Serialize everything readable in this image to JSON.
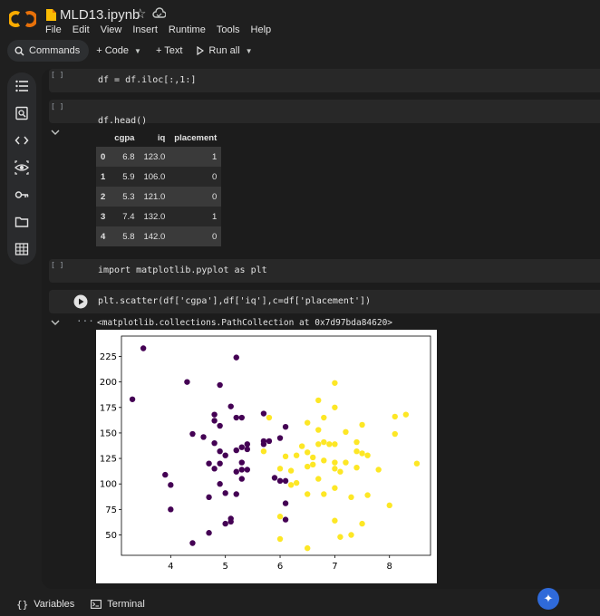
{
  "header": {
    "filename": "MLD13.ipynb",
    "star_glyph": "☆"
  },
  "menu": [
    "File",
    "Edit",
    "View",
    "Insert",
    "Runtime",
    "Tools",
    "Help"
  ],
  "toolbar": {
    "commands": "Commands",
    "code": "+ Code",
    "text": "+ Text",
    "run_all": "Run all"
  },
  "rail_icons": [
    "toc-icon",
    "find-icon",
    "code-snippets-icon",
    "variables-inspect-icon",
    "secrets-key-icon",
    "files-folder-icon",
    "table-icon"
  ],
  "cells": {
    "c1": {
      "bracket": "[ ]",
      "code": "df = df.iloc[:,1:]"
    },
    "c2": {
      "bracket": "[ ]",
      "code": "df.head()"
    },
    "c3": {
      "bracket": "[ ]",
      "code": "import matplotlib.pyplot as plt"
    },
    "c4": {
      "code": "plt.scatter(df['cgpa'],df['iq'],c=df['placement'])"
    }
  },
  "table": {
    "columns": [
      "",
      "cgpa",
      "iq",
      "placement"
    ],
    "rows": [
      [
        "0",
        "6.8",
        "123.0",
        "1"
      ],
      [
        "1",
        "5.9",
        "106.0",
        "0"
      ],
      [
        "2",
        "5.3",
        "121.0",
        "0"
      ],
      [
        "3",
        "7.4",
        "132.0",
        "1"
      ],
      [
        "4",
        "5.8",
        "142.0",
        "0"
      ]
    ]
  },
  "output_text": "<matplotlib.collections.PathCollection at 0x7d97bda84620>",
  "bottom": {
    "variables": "Variables",
    "terminal": "Terminal"
  },
  "colors": {
    "class0": "#440154",
    "class1": "#fde725",
    "accent_gemini": "#2f6ad9"
  },
  "chart_data": {
    "type": "scatter",
    "title": "",
    "xlabel": "",
    "ylabel": "",
    "xlim": [
      3.1,
      8.75
    ],
    "ylim": [
      30,
      245
    ],
    "xticks": [
      4,
      5,
      6,
      7,
      8
    ],
    "yticks": [
      50,
      75,
      100,
      125,
      150,
      175,
      200,
      225
    ],
    "points": [
      [
        3.5,
        233,
        0
      ],
      [
        3.3,
        183,
        0
      ],
      [
        4.3,
        200,
        0
      ],
      [
        4.4,
        149,
        0
      ],
      [
        4.6,
        146,
        0
      ],
      [
        3.9,
        109,
        0
      ],
      [
        4.0,
        99,
        0
      ],
      [
        4.0,
        75,
        0
      ],
      [
        4.4,
        42,
        0
      ],
      [
        4.7,
        52,
        0
      ],
      [
        4.8,
        162,
        0
      ],
      [
        4.8,
        168,
        0
      ],
      [
        4.9,
        157,
        0
      ],
      [
        4.8,
        140,
        0
      ],
      [
        4.9,
        132,
        0
      ],
      [
        4.7,
        120,
        0
      ],
      [
        4.8,
        115,
        0
      ],
      [
        4.9,
        120,
        0
      ],
      [
        5.0,
        128,
        0
      ],
      [
        4.9,
        100,
        0
      ],
      [
        4.7,
        87,
        0
      ],
      [
        5.0,
        91,
        0
      ],
      [
        5.0,
        61,
        0
      ],
      [
        5.1,
        63,
        0
      ],
      [
        5.1,
        66,
        0
      ],
      [
        4.9,
        197,
        0
      ],
      [
        5.2,
        224,
        0
      ],
      [
        5.1,
        176,
        0
      ],
      [
        5.2,
        165,
        0
      ],
      [
        5.3,
        165,
        0
      ],
      [
        5.3,
        121,
        0
      ],
      [
        5.2,
        133,
        0
      ],
      [
        5.3,
        136,
        0
      ],
      [
        5.4,
        139,
        0
      ],
      [
        5.4,
        134,
        0
      ],
      [
        5.3,
        114,
        0
      ],
      [
        5.2,
        112,
        0
      ],
      [
        5.3,
        105,
        0
      ],
      [
        5.4,
        114,
        0
      ],
      [
        5.2,
        90,
        0
      ],
      [
        5.7,
        169,
        0
      ],
      [
        5.7,
        142,
        0
      ],
      [
        5.7,
        139,
        0
      ],
      [
        5.8,
        142,
        0
      ],
      [
        5.9,
        106,
        0
      ],
      [
        6.0,
        103,
        0
      ],
      [
        6.1,
        103,
        0
      ],
      [
        6.1,
        81,
        0
      ],
      [
        6.1,
        65,
        0
      ],
      [
        6.0,
        145,
        0
      ],
      [
        6.1,
        156,
        0
      ],
      [
        5.8,
        165,
        1
      ],
      [
        5.7,
        132,
        1
      ],
      [
        6.0,
        115,
        1
      ],
      [
        6.0,
        46,
        1
      ],
      [
        6.0,
        68,
        1
      ],
      [
        6.1,
        127,
        1
      ],
      [
        6.2,
        113,
        1
      ],
      [
        6.3,
        128,
        1
      ],
      [
        6.2,
        99,
        1
      ],
      [
        6.3,
        101,
        1
      ],
      [
        6.4,
        137,
        1
      ],
      [
        6.5,
        160,
        1
      ],
      [
        6.5,
        131,
        1
      ],
      [
        6.5,
        117,
        1
      ],
      [
        6.5,
        90,
        1
      ],
      [
        6.5,
        37,
        1
      ],
      [
        6.7,
        182,
        1
      ],
      [
        6.7,
        153,
        1
      ],
      [
        6.7,
        139,
        1
      ],
      [
        6.6,
        126,
        1
      ],
      [
        6.6,
        119,
        1
      ],
      [
        6.7,
        105,
        1
      ],
      [
        6.8,
        123,
        1
      ],
      [
        6.8,
        141,
        1
      ],
      [
        6.8,
        90,
        1
      ],
      [
        6.8,
        165,
        1
      ],
      [
        6.9,
        139,
        1
      ],
      [
        7.0,
        139,
        1
      ],
      [
        7.0,
        199,
        1
      ],
      [
        7.0,
        175,
        1
      ],
      [
        7.0,
        121,
        1
      ],
      [
        7.0,
        115,
        1
      ],
      [
        7.0,
        64,
        1
      ],
      [
        7.0,
        96,
        1
      ],
      [
        7.1,
        48,
        1
      ],
      [
        7.1,
        112,
        1
      ],
      [
        7.2,
        151,
        1
      ],
      [
        7.2,
        121,
        1
      ],
      [
        7.3,
        50,
        1
      ],
      [
        7.3,
        87,
        1
      ],
      [
        7.4,
        132,
        1
      ],
      [
        7.4,
        141,
        1
      ],
      [
        7.4,
        116,
        1
      ],
      [
        7.5,
        130,
        1
      ],
      [
        7.5,
        158,
        1
      ],
      [
        7.5,
        61,
        1
      ],
      [
        7.6,
        128,
        1
      ],
      [
        7.6,
        89,
        1
      ],
      [
        7.8,
        114,
        1
      ],
      [
        8.0,
        79,
        1
      ],
      [
        8.1,
        166,
        1
      ],
      [
        8.1,
        149,
        1
      ],
      [
        8.3,
        168,
        1
      ],
      [
        8.5,
        120,
        1
      ]
    ]
  }
}
